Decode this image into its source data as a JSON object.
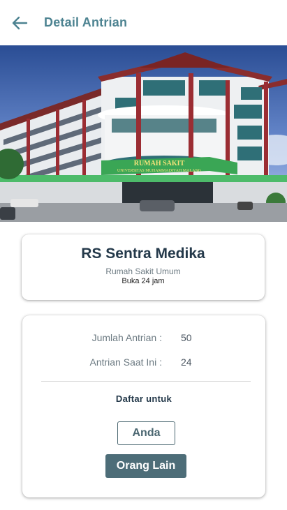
{
  "appbar": {
    "title": "Detail Antrian",
    "back_icon": "arrow-left-icon"
  },
  "hero": {
    "sign_line1": "RUMAH SAKIT",
    "sign_line2": "UNIVERSITAS MUHAMMADIYAH MALANG"
  },
  "hospital": {
    "name": "RS Sentra Medika",
    "type": "Rumah Sakit Umum",
    "hours": "Buka 24 jam"
  },
  "queue": {
    "total_label": "Jumlah Antrian :",
    "total_value": "50",
    "current_label": "Antrian Saat Ini :",
    "current_value": "24",
    "register_label": "Daftar untuk",
    "btn_self": "Anda",
    "btn_other": "Orang Lain"
  },
  "colors": {
    "accent": "#4d8391",
    "primary_button": "#4d6d78",
    "title_text": "#24394a"
  }
}
